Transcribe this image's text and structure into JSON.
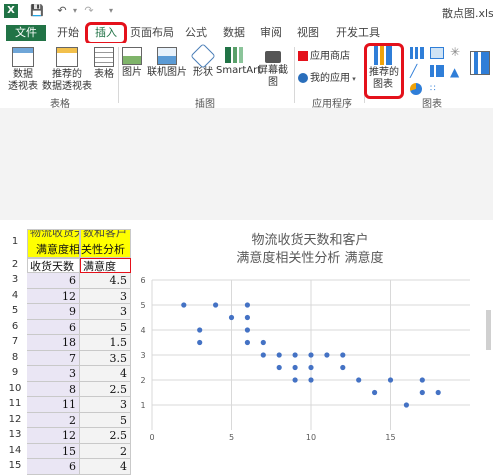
{
  "window": {
    "title": "散点图.xls"
  },
  "tabs": [
    "文件",
    "开始",
    "插入",
    "页面布局",
    "公式",
    "数据",
    "审阅",
    "视图",
    "开发工具"
  ],
  "ribbon": {
    "tables": {
      "pivot": "数据\n透视表",
      "recommended_pivot": "推荐的\n数据透视表",
      "table": "表格",
      "group": "表格"
    },
    "illustrations": {
      "picture": "图片",
      "online_picture": "联机图片",
      "shapes": "形状",
      "smartart": "SmartArt",
      "screenshot": "屏幕截图",
      "group": "插图"
    },
    "apps": {
      "store": "应用商店",
      "my_apps": "我的应用",
      "group": "应用程序"
    },
    "charts": {
      "recommended": "推荐的\n图表",
      "group": "图表"
    }
  },
  "sheet": {
    "header_row1": [
      "物流收货天",
      "数和客户"
    ],
    "header_row1b": [
      "满意度相",
      "关性分析"
    ],
    "header_row2": [
      "收货天数",
      "满意度"
    ],
    "rows": [
      [
        "6",
        "4.5"
      ],
      [
        "12",
        "3"
      ],
      [
        "9",
        "3"
      ],
      [
        "6",
        "5"
      ],
      [
        "18",
        "1.5"
      ],
      [
        "7",
        "3.5"
      ],
      [
        "3",
        "4"
      ],
      [
        "8",
        "2.5"
      ],
      [
        "11",
        "3"
      ],
      [
        "2",
        "5"
      ],
      [
        "12",
        "2.5"
      ],
      [
        "15",
        "2"
      ],
      [
        "6",
        "4"
      ]
    ],
    "row_numbers": [
      "1",
      "2",
      "3",
      "4",
      "5",
      "6",
      "7",
      "8",
      "9",
      "10",
      "11",
      "12",
      "13",
      "14",
      "15"
    ]
  },
  "chart_data": {
    "type": "scatter",
    "title": "物流收货天数和客户\n满意度相关性分析 满意度",
    "xlim": [
      0,
      20
    ],
    "ylim": [
      0,
      6
    ],
    "xticks": [
      "0",
      "5",
      "10",
      "15"
    ],
    "yticks": [
      "1",
      "2",
      "3",
      "4",
      "5",
      "6"
    ],
    "points": [
      [
        2,
        5
      ],
      [
        3,
        4
      ],
      [
        3,
        3.5
      ],
      [
        4,
        5
      ],
      [
        5,
        4.5
      ],
      [
        6,
        5
      ],
      [
        6,
        4.5
      ],
      [
        6,
        4
      ],
      [
        6,
        3.5
      ],
      [
        7,
        3.5
      ],
      [
        7,
        3
      ],
      [
        8,
        3
      ],
      [
        8,
        2.5
      ],
      [
        9,
        3
      ],
      [
        9,
        2.5
      ],
      [
        9,
        2
      ],
      [
        10,
        3
      ],
      [
        10,
        2.5
      ],
      [
        10,
        2
      ],
      [
        11,
        3
      ],
      [
        12,
        3
      ],
      [
        12,
        2.5
      ],
      [
        13,
        2
      ],
      [
        14,
        1.5
      ],
      [
        15,
        2
      ],
      [
        16,
        1
      ],
      [
        17,
        1.5
      ],
      [
        17,
        2
      ],
      [
        18,
        1.5
      ]
    ]
  },
  "colors": {
    "excel_green": "#217346",
    "highlight_red": "#e4111b",
    "header_fill": "#ffff00",
    "point": "#4472c4"
  }
}
